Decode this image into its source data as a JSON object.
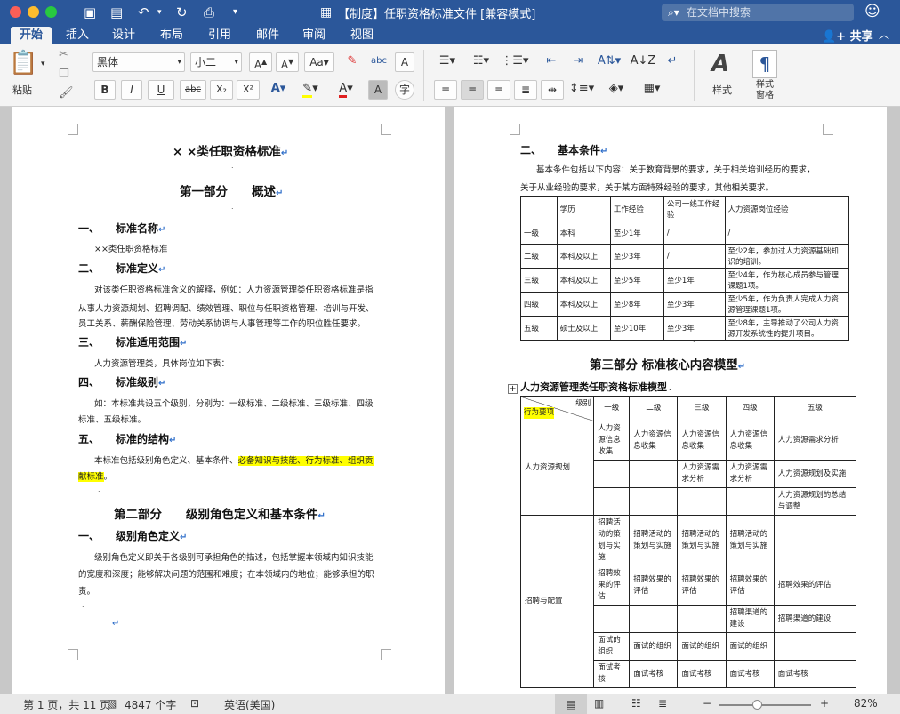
{
  "window": {
    "title": "【制度】任职资格标准文件 [兼容模式]"
  },
  "titlebar": {
    "search_placeholder": "在文档中搜索"
  },
  "tabs": [
    "开始",
    "插入",
    "设计",
    "布局",
    "引用",
    "邮件",
    "审阅",
    "视图"
  ],
  "share_label": "共享",
  "ribbon": {
    "paste": "粘贴",
    "font_name": "黑体",
    "font_size": "小二",
    "styles": "样式",
    "styles_pane": "样式\n窗格",
    "bold": "B",
    "italic": "I",
    "underline": "U",
    "strike": "abc",
    "sub": "X₂",
    "sup": "X²",
    "clear_format": "A",
    "char_shade": "A",
    "phonetic": "字"
  },
  "page1": {
    "title": "× ×类任职资格标准",
    "part1": "第一部分　　概述",
    "s1_num": "一、",
    "s1_title": "标准名称",
    "s1_body": "××类任职资格标准",
    "s2_num": "二、",
    "s2_title": "标准定义",
    "s2_body1": "对该类任职资格标准含义的解释，例如：人力资源管理类任职资格标准是指",
    "s2_body2": "从事人力资源规划、招聘调配、绩效管理、职位与任职资格管理、培训与开发、",
    "s2_body3": "员工关系、薪酬保险管理、劳动关系协调与人事管理等工作的职位胜任要求。",
    "s3_num": "三、",
    "s3_title": "标准适用范围",
    "s3_body": "人力资源管理类，具体岗位如下表：",
    "s4_num": "四、",
    "s4_title": "标准级别",
    "s4_body1": "如：本标准共设五个级别，分别为：一级标准、二级标准、三级标准、四级",
    "s4_body2": "标准、五级标准。",
    "s5_num": "五、",
    "s5_title": "标准的结构",
    "s5_body1a": "本标准包括级别角色定义、基本条件、",
    "s5_body1b": "必备知识与技能、行为标准、组织贡",
    "s5_body2a": "献标准",
    "s5_body2b": "。",
    "part2": "第二部分　　级别角色定义和基本条件",
    "p2s1_num": "一、",
    "p2s1_title": "级别角色定义",
    "p2s1_body1": "级别角色定义即关于各级别可承担角色的描述，包括掌握本领域内知识技能",
    "p2s1_body2": "的宽度和深度；能够解决问题的范围和难度；在本领域内的地位；能够承担的职",
    "p2s1_body3": "责。"
  },
  "page2": {
    "s2_num": "二、",
    "s2_title": "基本条件",
    "s2_body1": "基本条件包括以下内容：关于教育背景的要求，关于相关培训经历的要求，",
    "s2_body2": "关于从业经验的要求，关于某方面特殊经验的要求，其他相关要求。",
    "table1": {
      "headers": [
        "",
        "学历",
        "工作经验",
        "公司一线工作经验",
        "人力资源岗位经验"
      ],
      "rows": [
        [
          "一级",
          "本科",
          "至少1年",
          "/",
          "/"
        ],
        [
          "二级",
          "本科及以上",
          "至少3年",
          "/",
          "至少2年，参加过人力资源基础知识的培训。"
        ],
        [
          "三级",
          "本科及以上",
          "至少5年",
          "至少1年",
          "至少4年，作为核心成员参与管理课题1项。"
        ],
        [
          "四级",
          "本科及以上",
          "至少8年",
          "至少3年",
          "至少5年，作为负责人完成人力资源管理课题1项。"
        ],
        [
          "五级",
          "硕士及以上",
          "至少10年",
          "至少3年",
          "至少8年，主导推动了公司人力资源开发系统性的提升项目。"
        ]
      ]
    },
    "part3": "第三部分  标准核心内容模型",
    "model_title": "人力资源管理类任职资格标准模型",
    "table2": {
      "corner_top": "级别",
      "corner_bottom": "行为要项",
      "levels": [
        "一级",
        "二级",
        "三级",
        "四级",
        "五级"
      ],
      "group1": "人力资源规划",
      "g1rows": [
        [
          "人力资源信息收集",
          "人力资源信息收集",
          "人力资源信息收集",
          "人力资源信息收集",
          "人力资源需求分析"
        ],
        [
          "",
          "",
          "人力资源需求分析",
          "人力资源需求分析",
          "人力资源规划及实施"
        ],
        [
          "",
          "",
          "",
          "",
          "人力资源规划的总结与调整"
        ]
      ],
      "group2": "招聘与配置",
      "g2rows": [
        [
          "招聘活动的策划与实施",
          "招聘活动的策划与实施",
          "招聘活动的策划与实施",
          "招聘活动的策划与实施",
          ""
        ],
        [
          "招聘效果的评估",
          "招聘效果的评估",
          "招聘效果的评估",
          "招聘效果的评估",
          "招聘效果的评估"
        ],
        [
          "",
          "",
          "",
          "招聘渠道的建设",
          "招聘渠道的建设"
        ],
        [
          "面试的组织",
          "面试的组织",
          "面试的组织",
          "面试的组织",
          ""
        ],
        [
          "面试考核",
          "面试考核",
          "面试考核",
          "面试考核",
          "面试考核"
        ]
      ]
    }
  },
  "status": {
    "page": "第 1 页，共 11 页",
    "words": "4847 个字",
    "lang": "英语(美国)",
    "zoom": "82%"
  },
  "colors": {
    "brand": "#2b579a",
    "highlight": "#ffff00"
  }
}
